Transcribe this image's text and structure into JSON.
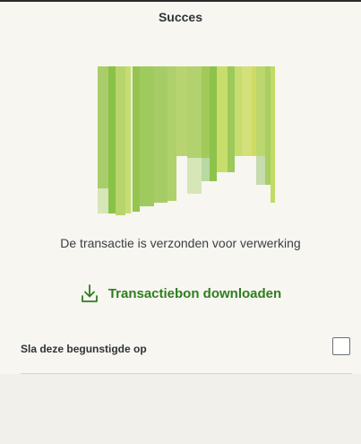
{
  "header": {
    "title": "Succes"
  },
  "illustration": {
    "icon": "barcode-receipt-illustration",
    "colors": {
      "primary": "#a6cc68",
      "dark": "#8dc24b",
      "light": "#c1db6a",
      "yellow": "#cfdc62",
      "pale": "#d6e6b6"
    }
  },
  "status": {
    "message": "De transactie is verzonden voor verwerking"
  },
  "download": {
    "icon": "download-icon",
    "label": "Transactiebon downloaden",
    "color": "#2f7d1f"
  },
  "save_beneficiary": {
    "label": "Sla deze begunstigde op",
    "checked": false
  }
}
